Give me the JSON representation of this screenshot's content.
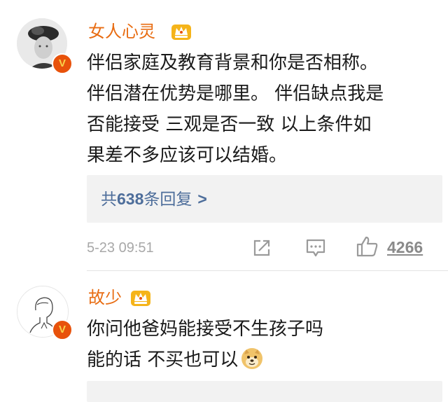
{
  "comments": [
    {
      "username": "女人心灵",
      "verified_badge": "V",
      "lines": [
        "伴侣家庭及教育背景和你是否相称。",
        "伴侣潜在优势是哪里。 伴侣缺点我是",
        "否能接受 三观是否一致 以上条件如",
        "果差不多应该可以结婚。"
      ],
      "replies_prefix": "共",
      "replies_count": "638",
      "replies_suffix": "条回复",
      "replies_chevron": ">",
      "time": "5-23 09:51",
      "like_count": "4266"
    },
    {
      "username": "故少",
      "verified_badge": "V",
      "lines": [
        "你问他爸妈能接受不生孩子吗",
        "能的话  不买也可以"
      ]
    }
  ],
  "icons": {
    "crown": "crown-vip-icon",
    "share": "share-icon",
    "comment": "comment-icon",
    "like": "thumbs-up-icon",
    "emoji": "doge-emoji-icon"
  },
  "colors": {
    "username": "#e86c12",
    "link": "#4e6e9b",
    "badge": "#e8520b",
    "meta": "#a8a8a8"
  }
}
